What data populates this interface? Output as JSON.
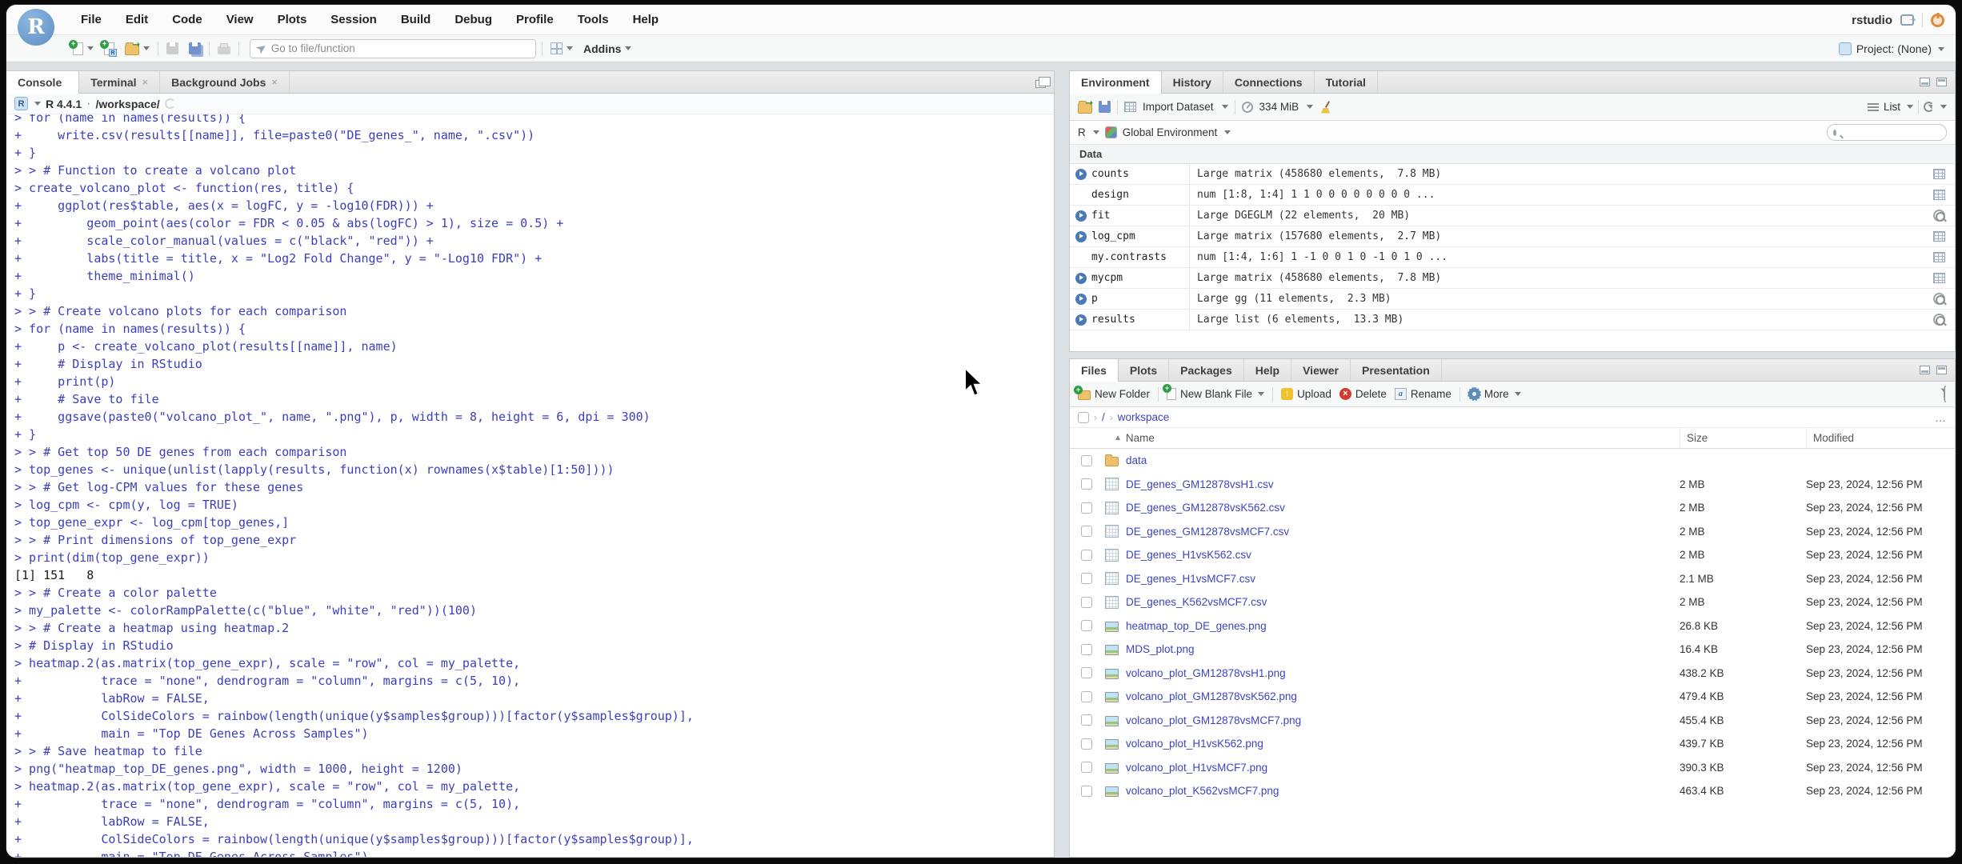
{
  "branding": {
    "logo_letter": "R"
  },
  "titlebar": {
    "menus": [
      "File",
      "Edit",
      "Code",
      "View",
      "Plots",
      "Session",
      "Build",
      "Debug",
      "Profile",
      "Tools",
      "Help"
    ],
    "user": "rstudio",
    "project": "Project: (None)"
  },
  "toolbar": {
    "goto_placeholder": "Go to file/function",
    "addins": "Addins"
  },
  "console_pane": {
    "tabs": [
      {
        "label": "Console",
        "state": "active",
        "close": ""
      },
      {
        "label": "Terminal",
        "state": "",
        "close": "×"
      },
      {
        "label": "Background Jobs",
        "state": "",
        "close": "×"
      }
    ],
    "r_badge": "R",
    "version": "R 4.4.1",
    "sep": "·",
    "cwd": "/workspace/",
    "lines": [
      {
        "k": "in",
        "text": "> for (name in names(results)) {"
      },
      {
        "k": "in",
        "text": "+     write.csv(results[[name]], file=paste0(\"DE_genes_\", name, \".csv\"))"
      },
      {
        "k": "in",
        "text": "+ }"
      },
      {
        "k": "in",
        "text": "> > # Function to create a volcano plot"
      },
      {
        "k": "in",
        "text": "> create_volcano_plot <- function(res, title) {"
      },
      {
        "k": "in",
        "text": "+     ggplot(res$table, aes(x = logFC, y = -log10(FDR))) +"
      },
      {
        "k": "in",
        "text": "+         geom_point(aes(color = FDR < 0.05 & abs(logFC) > 1), size = 0.5) +"
      },
      {
        "k": "in",
        "text": "+         scale_color_manual(values = c(\"black\", \"red\")) +"
      },
      {
        "k": "in",
        "text": "+         labs(title = title, x = \"Log2 Fold Change\", y = \"-Log10 FDR\") +"
      },
      {
        "k": "in",
        "text": "+         theme_minimal()"
      },
      {
        "k": "in",
        "text": "+ }"
      },
      {
        "k": "in",
        "text": "> > # Create volcano plots for each comparison"
      },
      {
        "k": "in",
        "text": "> for (name in names(results)) {"
      },
      {
        "k": "in",
        "text": "+     p <- create_volcano_plot(results[[name]], name)"
      },
      {
        "k": "in",
        "text": "+     # Display in RStudio"
      },
      {
        "k": "in",
        "text": "+     print(p)"
      },
      {
        "k": "in",
        "text": "+     # Save to file"
      },
      {
        "k": "in",
        "text": "+     ggsave(paste0(\"volcano_plot_\", name, \".png\"), p, width = 8, height = 6, dpi = 300)"
      },
      {
        "k": "in",
        "text": "+ }"
      },
      {
        "k": "in",
        "text": "> > # Get top 50 DE genes from each comparison"
      },
      {
        "k": "in",
        "text": "> top_genes <- unique(unlist(lapply(results, function(x) rownames(x$table)[1:50])))"
      },
      {
        "k": "in",
        "text": "> > # Get log-CPM values for these genes"
      },
      {
        "k": "in",
        "text": "> log_cpm <- cpm(y, log = TRUE)"
      },
      {
        "k": "in",
        "text": "> top_gene_expr <- log_cpm[top_genes,]"
      },
      {
        "k": "in",
        "text": "> > # Print dimensions of top_gene_expr"
      },
      {
        "k": "in",
        "text": "> print(dim(top_gene_expr))"
      },
      {
        "k": "out",
        "text": "[1] 151   8"
      },
      {
        "k": "in",
        "text": "> > # Create a color palette"
      },
      {
        "k": "in",
        "text": "> my_palette <- colorRampPalette(c(\"blue\", \"white\", \"red\"))(100)"
      },
      {
        "k": "in",
        "text": "> > # Create a heatmap using heatmap.2"
      },
      {
        "k": "in",
        "text": "> # Display in RStudio"
      },
      {
        "k": "in",
        "text": "> heatmap.2(as.matrix(top_gene_expr), scale = \"row\", col = my_palette,"
      },
      {
        "k": "in",
        "text": "+           trace = \"none\", dendrogram = \"column\", margins = c(5, 10),"
      },
      {
        "k": "in",
        "text": "+           labRow = FALSE,"
      },
      {
        "k": "in",
        "text": "+           ColSideColors = rainbow(length(unique(y$samples$group)))[factor(y$samples$group)],"
      },
      {
        "k": "in",
        "text": "+           main = \"Top DE Genes Across Samples\")"
      },
      {
        "k": "in",
        "text": "> > # Save heatmap to file"
      },
      {
        "k": "in",
        "text": "> png(\"heatmap_top_DE_genes.png\", width = 1000, height = 1200)"
      },
      {
        "k": "in",
        "text": "> heatmap.2(as.matrix(top_gene_expr), scale = \"row\", col = my_palette,"
      },
      {
        "k": "in",
        "text": "+           trace = \"none\", dendrogram = \"column\", margins = c(5, 10),"
      },
      {
        "k": "in",
        "text": "+           labRow = FALSE,"
      },
      {
        "k": "in",
        "text": "+           ColSideColors = rainbow(length(unique(y$samples$group)))[factor(y$samples$group)],"
      },
      {
        "k": "in",
        "text": "+           main = \"Top DE Genes Across Samples\")"
      }
    ]
  },
  "environment_pane": {
    "tabs": [
      {
        "label": "Environment",
        "state": "active",
        "close": ""
      },
      {
        "label": "History",
        "state": "",
        "close": ""
      },
      {
        "label": "Connections",
        "state": "",
        "close": ""
      },
      {
        "label": "Tutorial",
        "state": "",
        "close": ""
      }
    ],
    "toolbar": {
      "import": "Import Dataset",
      "memory": "334 MiB",
      "list": "List"
    },
    "env_bar": {
      "engine": "R",
      "scope": "Global Environment"
    },
    "section": "Data",
    "items": [
      {
        "name": "counts",
        "value": "Large matrix (458680 elements,  7.8 MB)",
        "exp": "exp",
        "icon": "grid"
      },
      {
        "name": "design",
        "value": "num [1:8, 1:4] 1 1 0 0 0 0 0 0 0 0 ...",
        "exp": "noexp",
        "icon": "grid"
      },
      {
        "name": "fit",
        "value": "Large DGEGLM (22 elements,  20 MB)",
        "exp": "exp",
        "icon": "mag"
      },
      {
        "name": "log_cpm",
        "value": "Large matrix (157680 elements,  2.7 MB)",
        "exp": "exp",
        "icon": "grid"
      },
      {
        "name": "my.contrasts",
        "value": "num [1:4, 1:6] 1 -1 0 0 1 0 -1 0 1 0 ...",
        "exp": "noexp",
        "icon": "grid"
      },
      {
        "name": "mycpm",
        "value": "Large matrix (458680 elements,  7.8 MB)",
        "exp": "exp",
        "icon": "grid"
      },
      {
        "name": "p",
        "value": "Large gg (11 elements,  2.3 MB)",
        "exp": "exp",
        "icon": "mag"
      },
      {
        "name": "results",
        "value": "Large list (6 elements,  13.3 MB)",
        "exp": "exp",
        "icon": "mag"
      }
    ]
  },
  "files_pane": {
    "tabs": [
      {
        "label": "Files",
        "state": "active",
        "close": ""
      },
      {
        "label": "Plots",
        "state": "",
        "close": ""
      },
      {
        "label": "Packages",
        "state": "",
        "close": ""
      },
      {
        "label": "Help",
        "state": "",
        "close": ""
      },
      {
        "label": "Viewer",
        "state": "",
        "close": ""
      },
      {
        "label": "Presentation",
        "state": "",
        "close": ""
      }
    ],
    "toolbar": {
      "new_folder": "New Folder",
      "new_file": "New Blank File",
      "upload": "Upload",
      "delete": "Delete",
      "rename": "Rename",
      "more": "More"
    },
    "breadcrumb": {
      "root": "/",
      "dir": "workspace",
      "more": "…"
    },
    "columns": {
      "name": "Name",
      "size": "Size",
      "modified": "Modified"
    },
    "rows": [
      {
        "name": "data",
        "type": "folder",
        "size": "",
        "modified": ""
      },
      {
        "name": "DE_genes_GM12878vsH1.csv",
        "type": "csv",
        "size": "2 MB",
        "modified": "Sep 23, 2024, 12:56 PM"
      },
      {
        "name": "DE_genes_GM12878vsK562.csv",
        "type": "csv",
        "size": "2 MB",
        "modified": "Sep 23, 2024, 12:56 PM"
      },
      {
        "name": "DE_genes_GM12878vsMCF7.csv",
        "type": "csv",
        "size": "2 MB",
        "modified": "Sep 23, 2024, 12:56 PM"
      },
      {
        "name": "DE_genes_H1vsK562.csv",
        "type": "csv",
        "size": "2 MB",
        "modified": "Sep 23, 2024, 12:56 PM"
      },
      {
        "name": "DE_genes_H1vsMCF7.csv",
        "type": "csv",
        "size": "2.1 MB",
        "modified": "Sep 23, 2024, 12:56 PM"
      },
      {
        "name": "DE_genes_K562vsMCF7.csv",
        "type": "csv",
        "size": "2 MB",
        "modified": "Sep 23, 2024, 12:56 PM"
      },
      {
        "name": "heatmap_top_DE_genes.png",
        "type": "png",
        "size": "26.8 KB",
        "modified": "Sep 23, 2024, 12:56 PM"
      },
      {
        "name": "MDS_plot.png",
        "type": "png",
        "size": "16.4 KB",
        "modified": "Sep 23, 2024, 12:56 PM"
      },
      {
        "name": "volcano_plot_GM12878vsH1.png",
        "type": "png",
        "size": "438.2 KB",
        "modified": "Sep 23, 2024, 12:56 PM"
      },
      {
        "name": "volcano_plot_GM12878vsK562.png",
        "type": "png",
        "size": "479.4 KB",
        "modified": "Sep 23, 2024, 12:56 PM"
      },
      {
        "name": "volcano_plot_GM12878vsMCF7.png",
        "type": "png",
        "size": "455.4 KB",
        "modified": "Sep 23, 2024, 12:56 PM"
      },
      {
        "name": "volcano_plot_H1vsK562.png",
        "type": "png",
        "size": "439.7 KB",
        "modified": "Sep 23, 2024, 12:56 PM"
      },
      {
        "name": "volcano_plot_H1vsMCF7.png",
        "type": "png",
        "size": "390.3 KB",
        "modified": "Sep 23, 2024, 12:56 PM"
      },
      {
        "name": "volcano_plot_K562vsMCF7.png",
        "type": "png",
        "size": "463.4 KB",
        "modified": "Sep 23, 2024, 12:56 PM"
      }
    ]
  }
}
